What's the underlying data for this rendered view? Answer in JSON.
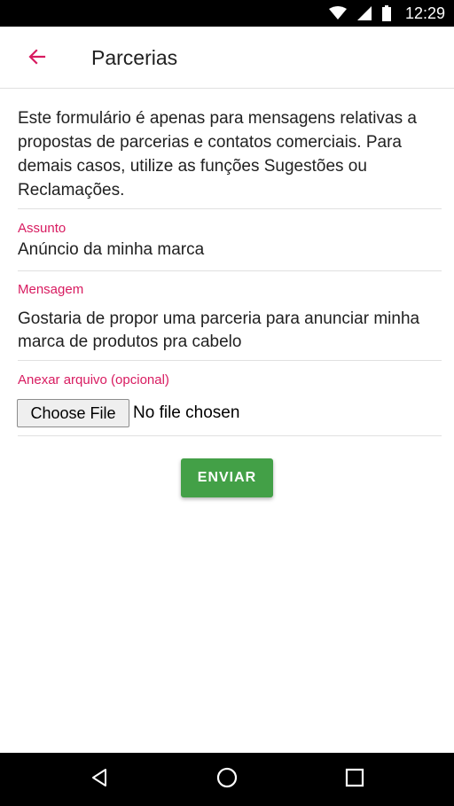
{
  "status_bar": {
    "time": "12:29",
    "icons": [
      "wifi-icon",
      "signal-icon",
      "battery-icon"
    ]
  },
  "app_bar": {
    "title": "Parcerias",
    "back_icon": "arrow-left-icon"
  },
  "intro_text": "Este formulário é apenas para mensagens relativas a propostas de parcerias e contatos comerciais. Para demais casos, utilize as funções Sugestões ou Reclamações.",
  "form": {
    "subject": {
      "label": "Assunto",
      "value": "Anúncio da minha marca"
    },
    "message": {
      "label": "Mensagem",
      "value": "Gostaria de propor uma parceria para anunciar minha marca de produtos pra cabelo"
    },
    "attachment": {
      "label": "Anexar arquivo (opcional)",
      "button_label": "Choose File",
      "status": "No file chosen"
    },
    "submit_label": "ENVIAR"
  },
  "nav_bar": {
    "icons": [
      "back-triangle-icon",
      "home-circle-icon",
      "recents-square-icon"
    ]
  },
  "colors": {
    "accent": "#d81b60",
    "submit": "#43a047",
    "text": "#212121"
  }
}
